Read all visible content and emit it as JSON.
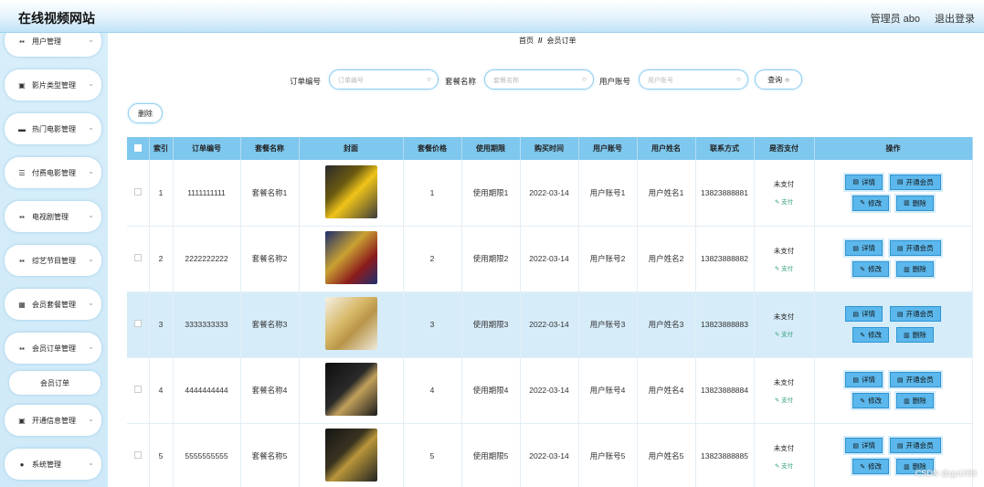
{
  "header": {
    "site_title": "在线视频网站",
    "admin_label": "管理员 abo",
    "logout_label": "退出登录"
  },
  "sidebar": {
    "items": [
      {
        "label": "用户管理",
        "icon": "grid-icon"
      },
      {
        "label": "影片类型管理",
        "icon": "doc-icon"
      },
      {
        "label": "热门电影管理",
        "icon": "folder-icon"
      },
      {
        "label": "付费电影管理",
        "icon": "sliders-icon"
      },
      {
        "label": "电视剧管理",
        "icon": "grid-icon"
      },
      {
        "label": "综艺节目管理",
        "icon": "grid-icon"
      },
      {
        "label": "会员套餐管理",
        "icon": "grid-icon"
      },
      {
        "label": "会员订单管理",
        "icon": "grid-icon"
      },
      {
        "label": "开通信息管理",
        "icon": "doc-icon"
      },
      {
        "label": "系统管理",
        "icon": "user-icon"
      }
    ],
    "sub_item": "会员订单"
  },
  "breadcrumb": {
    "home": "首页",
    "sep": "//",
    "current": "会员订单"
  },
  "search": {
    "order_no_label": "订单编号",
    "order_no_placeholder": "订单编号",
    "package_label": "套餐名称",
    "package_placeholder": "套餐名称",
    "account_label": "用户账号",
    "account_placeholder": "用户账号",
    "query_label": "查询"
  },
  "delete_label": "删除",
  "table": {
    "columns": [
      "索引",
      "订单编号",
      "套餐名称",
      "封面",
      "套餐价格",
      "使用期限",
      "购买时间",
      "用户账号",
      "用户姓名",
      "联系方式",
      "是否支付",
      "操作"
    ],
    "rows": [
      {
        "index": "1",
        "order_no": "1111111111",
        "package": "套餐名称1",
        "price": "1",
        "term": "使用期限1",
        "time": "2022-03-14",
        "account": "用户账号1",
        "name": "用户姓名1",
        "phone": "13823888881",
        "paid": "未支付",
        "pay_link": "支付"
      },
      {
        "index": "2",
        "order_no": "2222222222",
        "package": "套餐名称2",
        "price": "2",
        "term": "使用期限2",
        "time": "2022-03-14",
        "account": "用户账号2",
        "name": "用户姓名2",
        "phone": "13823888882",
        "paid": "未支付",
        "pay_link": "支付"
      },
      {
        "index": "3",
        "order_no": "3333333333",
        "package": "套餐名称3",
        "price": "3",
        "term": "使用期限3",
        "time": "2022-03-14",
        "account": "用户账号3",
        "name": "用户姓名3",
        "phone": "13823888883",
        "paid": "未支付",
        "pay_link": "支付"
      },
      {
        "index": "4",
        "order_no": "4444444444",
        "package": "套餐名称4",
        "price": "4",
        "term": "使用期限4",
        "time": "2022-03-14",
        "account": "用户账号4",
        "name": "用户姓名4",
        "phone": "13823888884",
        "paid": "未支付",
        "pay_link": "支付"
      },
      {
        "index": "5",
        "order_no": "5555555555",
        "package": "套餐名称5",
        "price": "5",
        "term": "使用期限5",
        "time": "2022-03-14",
        "account": "用户账号5",
        "name": "用户姓名5",
        "phone": "13823888885",
        "paid": "未支付",
        "pay_link": "支付"
      }
    ],
    "actions": {
      "detail": "详情",
      "open_member": "开通会员",
      "edit": "修改",
      "delete": "删除"
    }
  },
  "watermark": "CSDN @gp1083",
  "colors": {
    "header_bg": "#bfe3f7",
    "table_header": "#7ec7ee",
    "button_blue": "#5cb8ec",
    "highlight_row": "#d6ecf9",
    "pay_link": "#35a07a"
  }
}
